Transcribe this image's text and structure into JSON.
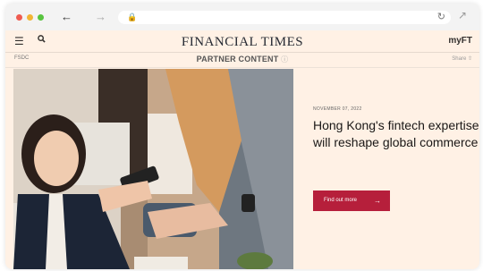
{
  "browser": {
    "back_icon": "arrow-left-icon",
    "forward_icon": "arrow-right-icon",
    "lock_icon": "lock-icon",
    "reload_icon": "reload-icon",
    "extension_icon": "extension-icon"
  },
  "site": {
    "menu_icon": "menu-icon",
    "search_icon": "search-icon",
    "logo": "FINANCIAL TIMES",
    "myft": "myFT"
  },
  "subbar": {
    "sponsor": "FSDC",
    "label": "PARTNER CONTENT",
    "share": "Share"
  },
  "article": {
    "date": "NOVEMBER 07, 2022",
    "headline": "Hong Kong's fintech expertise will reshape global commerce",
    "cta_label": "Find out more"
  },
  "colors": {
    "page_bg": "#fff1e5",
    "cta_bg": "#b61f3b"
  }
}
